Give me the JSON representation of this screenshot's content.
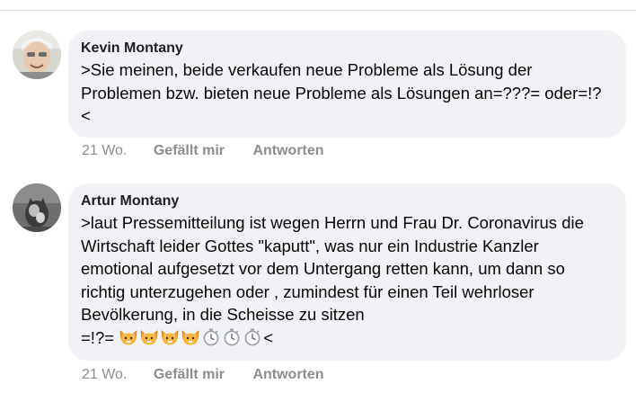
{
  "comments": [
    {
      "author": "Kevin Montany",
      "text": ">Sie meinen, beide verkaufen neue Probleme als Lösung der Problemen bzw. bieten neue Probleme als Lösungen an=???= oder=!?<",
      "time": "21 Wo.",
      "like_label": "Gefällt mir",
      "reply_label": "Antworten"
    },
    {
      "author": "Artur Montany",
      "text": ">laut Pressemitteilung ist wegen Herrn und Frau Dr. Coronavirus die Wirtschaft leider Gottes \"kaputt\", was nur ein Industrie Kanzler emotional aufgesetzt vor dem Untergang retten kann, um dann so richtig unterzugehen oder , zumindest für einen Teil wehrloser Bevölkerung, in die Scheisse zu sitzen",
      "text_end_prefix": "=!?=",
      "text_end_suffix": "<",
      "emojis": [
        "cat-face-icon",
        "cat-face-icon",
        "cat-face-icon",
        "cat-face-icon",
        "stopwatch-icon",
        "stopwatch-icon",
        "stopwatch-icon"
      ],
      "time": "21 Wo.",
      "like_label": "Gefällt mir",
      "reply_label": "Antworten"
    }
  ],
  "colors": {
    "bubble": "#f0f2f5",
    "meta_text": "#8a8d91",
    "author_text": "#1c1e21",
    "divider": "#dadde1"
  }
}
